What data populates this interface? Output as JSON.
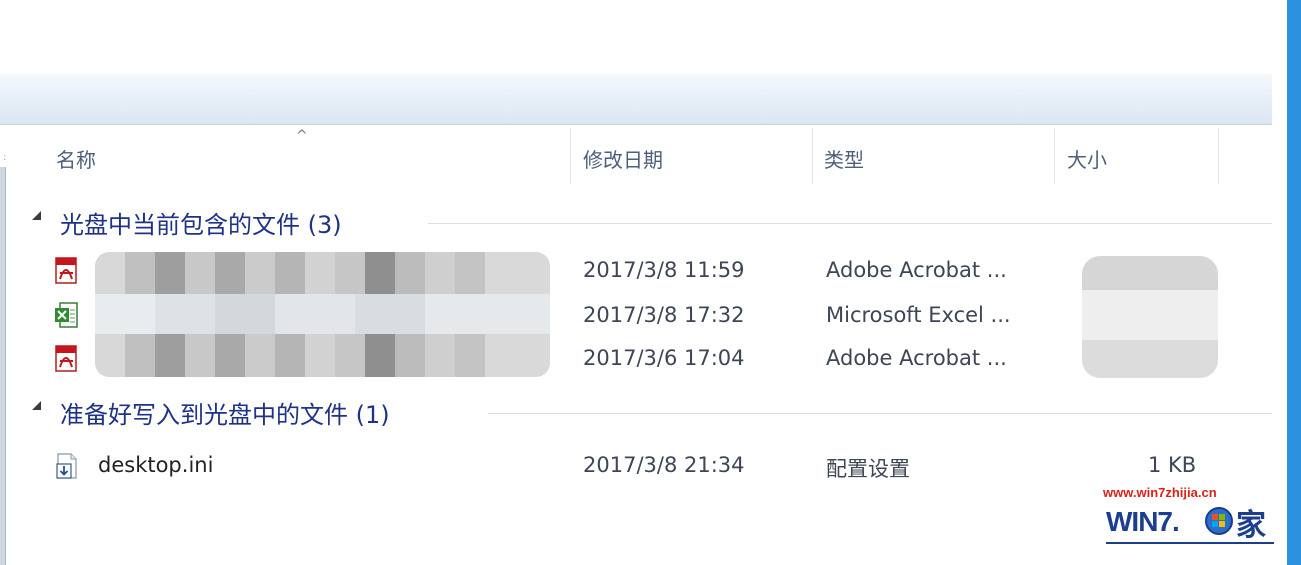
{
  "columns": {
    "name": "名称",
    "modified": "修改日期",
    "type": "类型",
    "size": "大小"
  },
  "groups": [
    {
      "title": "光盘中当前包含的文件 (3)",
      "files": [
        {
          "icon": "pdf-icon",
          "name": "",
          "modified": "2017/3/8 11:59",
          "type": "Adobe Acrobat ...",
          "size": ""
        },
        {
          "icon": "excel-icon",
          "name": "",
          "modified": "2017/3/8 17:32",
          "type": "Microsoft Excel ...",
          "size": ""
        },
        {
          "icon": "pdf-icon",
          "name": "",
          "modified": "2017/3/6 17:04",
          "type": "Adobe Acrobat ...",
          "size": ""
        }
      ]
    },
    {
      "title": "准备好写入到光盘中的文件 (1)",
      "files": [
        {
          "icon": "ini-settings-icon",
          "name": "desktop.ini",
          "modified": "2017/3/8 21:34",
          "type": "配置设置",
          "size": "1 KB"
        }
      ]
    }
  ],
  "watermark": {
    "url": "www.win7zhijia.cn",
    "logo_text": "WIN7.",
    "logo_char": "家"
  },
  "colors": {
    "group_title": "#1e3287",
    "header_text": "#4d5f7b",
    "window_border": "#2c92e0",
    "watermark_url": "#d8221a",
    "logo": "#1b3e8f"
  }
}
